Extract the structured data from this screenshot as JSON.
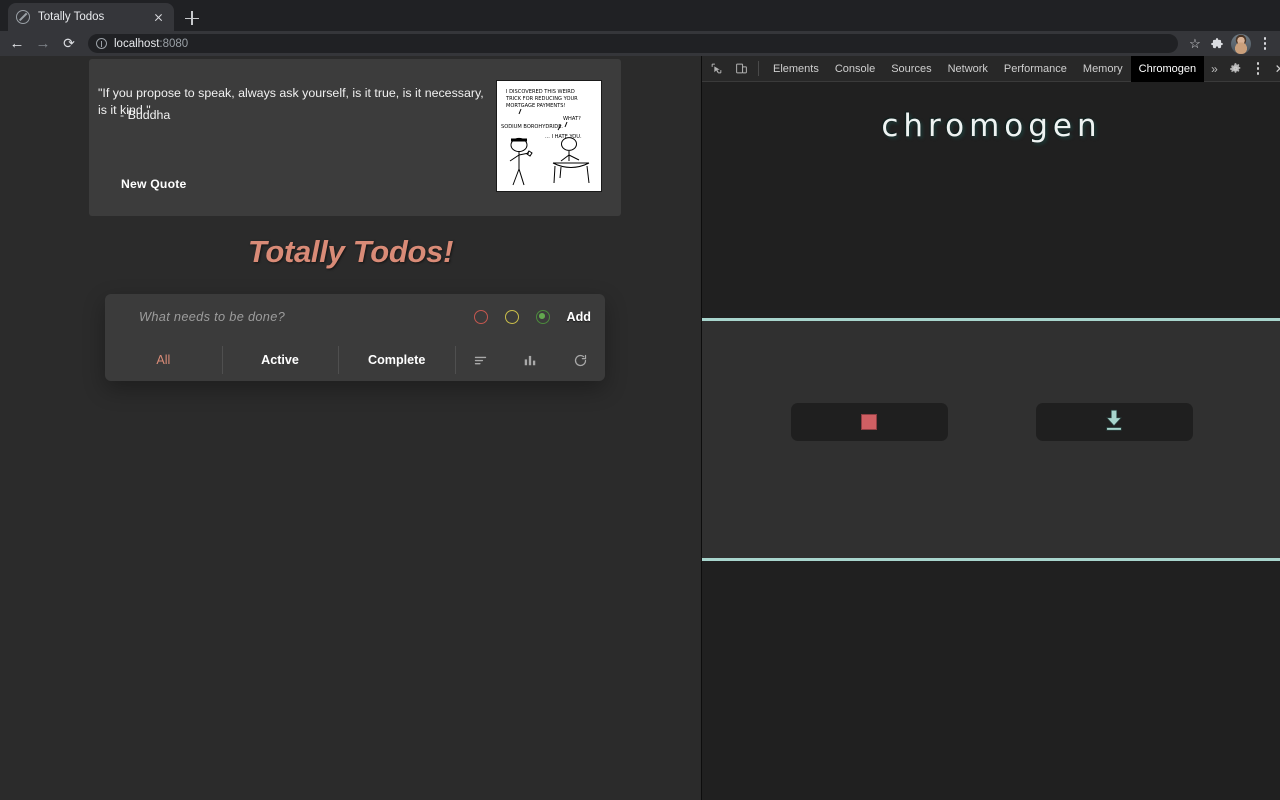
{
  "browser": {
    "tab": {
      "title": "Totally Todos",
      "favicon_name": "no-entry-favicon",
      "close_label": "×"
    },
    "new_tab_label": "+",
    "nav": {
      "back_label": "←",
      "forward_label": "→",
      "reload_label": "⟳"
    },
    "omnibox": {
      "url_host": "localhost",
      "url_port": ":8080",
      "info_icon": "page-info-icon"
    },
    "actions": {
      "bookmark_label": "☆",
      "extensions_label": "🧩",
      "profile_name": "avatar",
      "menu_label": "⋮"
    }
  },
  "page": {
    "quote_card": {
      "quote": "\"If you propose to speak, always ask yourself, is it true, is it necessary, is it kind.\"",
      "author": "- Buddha",
      "new_quote_button": "New Quote",
      "comic_alt": "xkcd comic panel",
      "comic_lines": [
        "I DISCOVERED THIS WEIRD",
        "TRICK FOR REDUCING YOUR",
        "MORTGAGE PAYMENTS!",
        "WHAT?",
        "SODIUM BOROHYDRIDE.",
        "... I HATE YOU."
      ]
    },
    "app_title": "Totally Todos!",
    "todo": {
      "input_placeholder": "What needs to be done?",
      "input_value": "",
      "add_button": "Add",
      "priorities": [
        {
          "name": "priority-low",
          "color": "#c4574f",
          "selected": false
        },
        {
          "name": "priority-medium",
          "color": "#c9bd4a",
          "selected": false
        },
        {
          "name": "priority-high",
          "color": "#63a84f",
          "selected": true
        }
      ],
      "filters": [
        {
          "label": "All",
          "active": true
        },
        {
          "label": "Active",
          "active": false
        },
        {
          "label": "Complete",
          "active": false
        }
      ],
      "tools": [
        {
          "name": "sort-icon",
          "label": "sort"
        },
        {
          "name": "bar-chart-icon",
          "label": "stats"
        },
        {
          "name": "refresh-icon",
          "label": "reset"
        }
      ]
    },
    "colors": {
      "accent": "#d98b77",
      "page_bg": "#2b2b2b",
      "card_bg": "#3b3b3b"
    }
  },
  "devtools": {
    "left_icons": [
      {
        "name": "inspect-element-icon"
      },
      {
        "name": "device-toolbar-icon"
      }
    ],
    "tabs": [
      {
        "label": "Elements",
        "active": false
      },
      {
        "label": "Console",
        "active": false
      },
      {
        "label": "Sources",
        "active": false
      },
      {
        "label": "Network",
        "active": false
      },
      {
        "label": "Performance",
        "active": false
      },
      {
        "label": "Memory",
        "active": false
      },
      {
        "label": "Chromogen",
        "active": true
      }
    ],
    "more_tabs_label": "»",
    "right_icons": [
      {
        "name": "settings-gear-icon",
        "label": "⚙"
      },
      {
        "name": "more-options-icon",
        "label": "⋮"
      },
      {
        "name": "close-devtools-icon",
        "label": "✕"
      }
    ],
    "chromogen": {
      "logo": "chromogen",
      "accent_color": "#a8d5cd",
      "buttons": [
        {
          "name": "stop-recording-button",
          "icon": "red-square-icon",
          "color": "#cf5f63"
        },
        {
          "name": "download-tests-button",
          "icon": "download-icon",
          "color": "#a8d5cd"
        }
      ]
    }
  }
}
